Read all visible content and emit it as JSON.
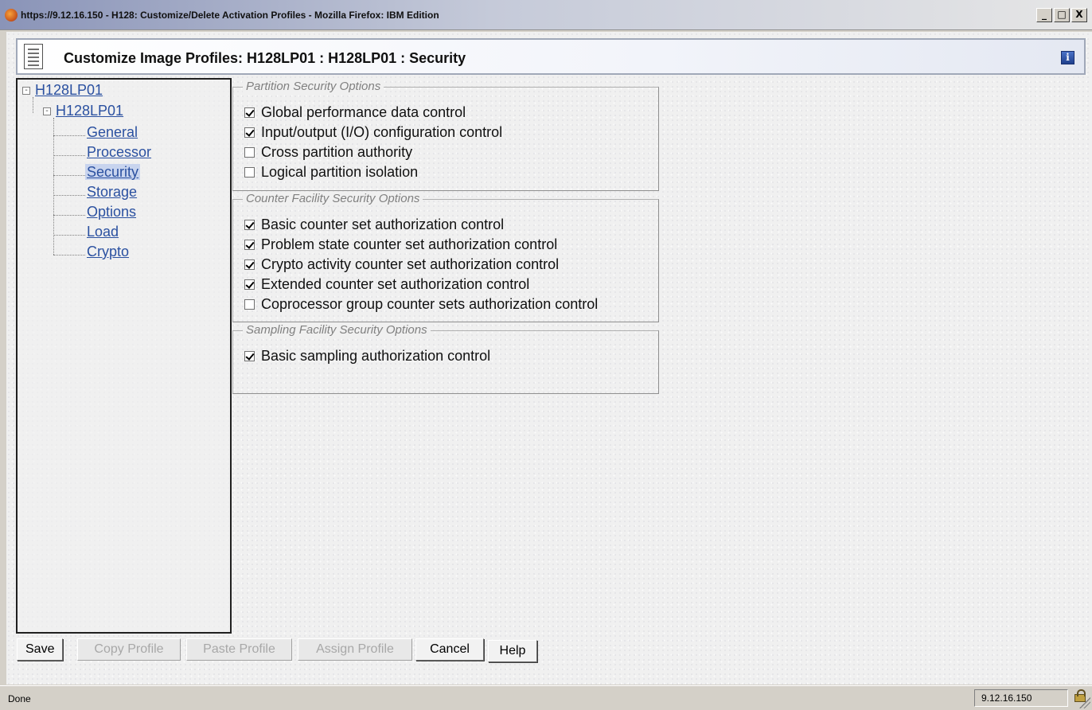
{
  "window": {
    "title": "https://9.12.16.150 - H128: Customize/Delete Activation Profiles - Mozilla Firefox: IBM Edition",
    "buttons": [
      "_",
      "□",
      "X"
    ]
  },
  "header": {
    "title": "Customize Image Profiles: H128LP01 : H128LP01 : Security",
    "info_icon_label": "i"
  },
  "tree": {
    "root": "H128LP01",
    "child": "H128LP01",
    "items": [
      "General",
      "Processor",
      "Security",
      "Storage",
      "Options",
      "Load",
      "Crypto"
    ],
    "selected": "Security",
    "expander": "-"
  },
  "groups": {
    "partition": {
      "legend": "Partition Security Options",
      "options": [
        {
          "label": "Global performance data control",
          "checked": true
        },
        {
          "label": "Input/output (I/O) configuration control",
          "checked": true
        },
        {
          "label": "Cross partition authority",
          "checked": false
        },
        {
          "label": "Logical partition isolation",
          "checked": false
        }
      ]
    },
    "counter": {
      "legend": "Counter Facility Security Options",
      "options": [
        {
          "label": "Basic counter set authorization control",
          "checked": true
        },
        {
          "label": "Problem state counter set authorization control",
          "checked": true
        },
        {
          "label": "Crypto activity counter set authorization control",
          "checked": true
        },
        {
          "label": "Extended counter set authorization control",
          "checked": true
        },
        {
          "label": "Coprocessor group counter sets authorization control",
          "checked": false
        }
      ]
    },
    "sampling": {
      "legend": "Sampling Facility Security Options",
      "options": [
        {
          "label": "Basic sampling authorization control",
          "checked": true
        }
      ]
    }
  },
  "buttons": {
    "save": "Save",
    "copy": "Copy Profile",
    "paste": "Paste Profile",
    "assign": "Assign Profile",
    "cancel": "Cancel",
    "help": "Help"
  },
  "status": {
    "text": "Done",
    "host": "9.12.16.150"
  }
}
